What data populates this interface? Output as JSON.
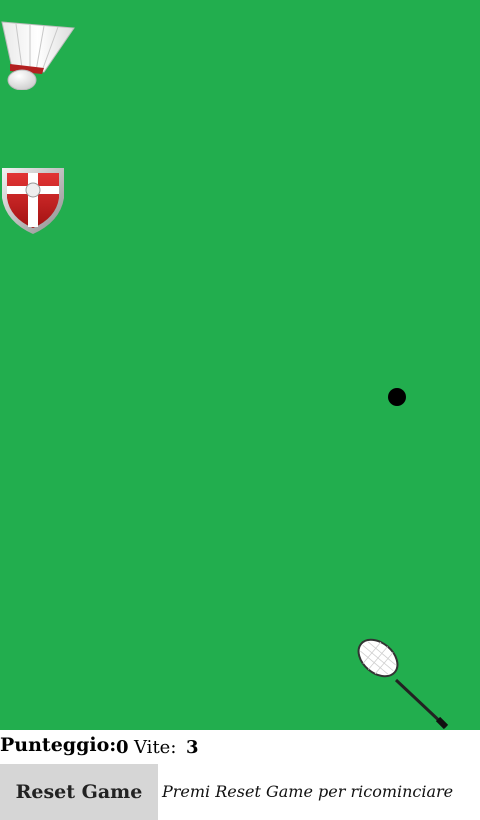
{
  "field": {
    "background": "#22ae4e",
    "sprites": [
      "shuttlecock-icon",
      "shield-icon",
      "ball-icon",
      "racket-icon"
    ]
  },
  "status": {
    "score_label": "Punteggio:",
    "score_value": "0",
    "lives_label": "Vite:",
    "lives_value": "3"
  },
  "controls": {
    "reset_label": "Reset Game",
    "message": "Premi Reset Game per ricominciare"
  }
}
